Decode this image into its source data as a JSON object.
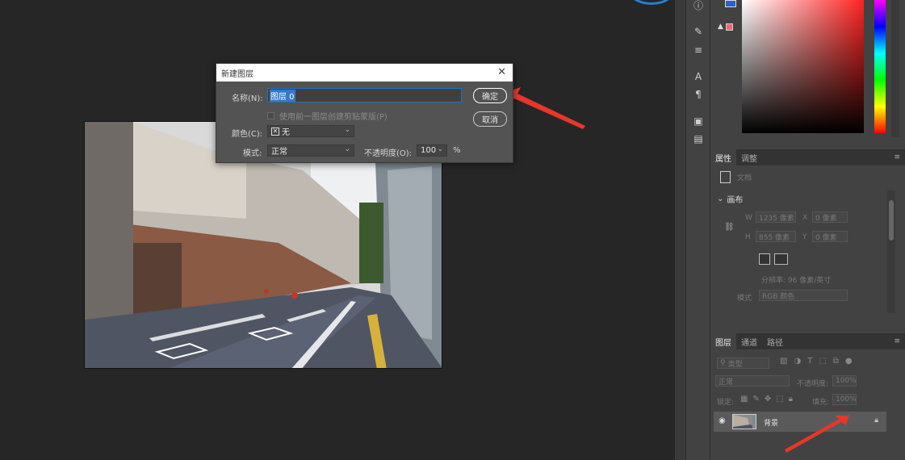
{
  "dialog": {
    "title": "新建图层",
    "name_label": "名称(N):",
    "name_value": "图层 0",
    "clip_checkbox_label": "使用前一图层创建剪贴蒙版(P)",
    "color_label": "颜色(C):",
    "color_value": "无",
    "mode_label": "模式:",
    "mode_value": "正常",
    "opacity_label": "不透明度(O):",
    "opacity_value": "100",
    "opacity_unit": "%",
    "ok_label": "确定",
    "cancel_label": "取消"
  },
  "properties_panel": {
    "tabs": [
      "属性",
      "调整"
    ],
    "doc_label": "文档",
    "section_canvas": "画布",
    "w_label": "W",
    "w_value": "1235 像素",
    "h_label": "H",
    "h_value": "855 像素",
    "x_label": "X",
    "x_value": "0 像素",
    "y_label": "Y",
    "y_value": "0 像素",
    "resolution": "分辨率: 96 像素/英寸",
    "mode_label": "模式",
    "mode_value": "RGB 颜色"
  },
  "layers_panel": {
    "tabs": [
      "图层",
      "通道",
      "路径"
    ],
    "filter_placeholder": "类型",
    "blend_mode": "正常",
    "opacity_label": "不透明度:",
    "opacity_value": "100%",
    "lock_label": "锁定:",
    "fill_label": "填充:",
    "fill_value": "100%",
    "layer_name": "背景"
  },
  "colors": {
    "accent_blue": "#3478c6",
    "arrow_red": "#e8362c",
    "panel_bg": "#424242",
    "canvas_bg": "#262626"
  }
}
